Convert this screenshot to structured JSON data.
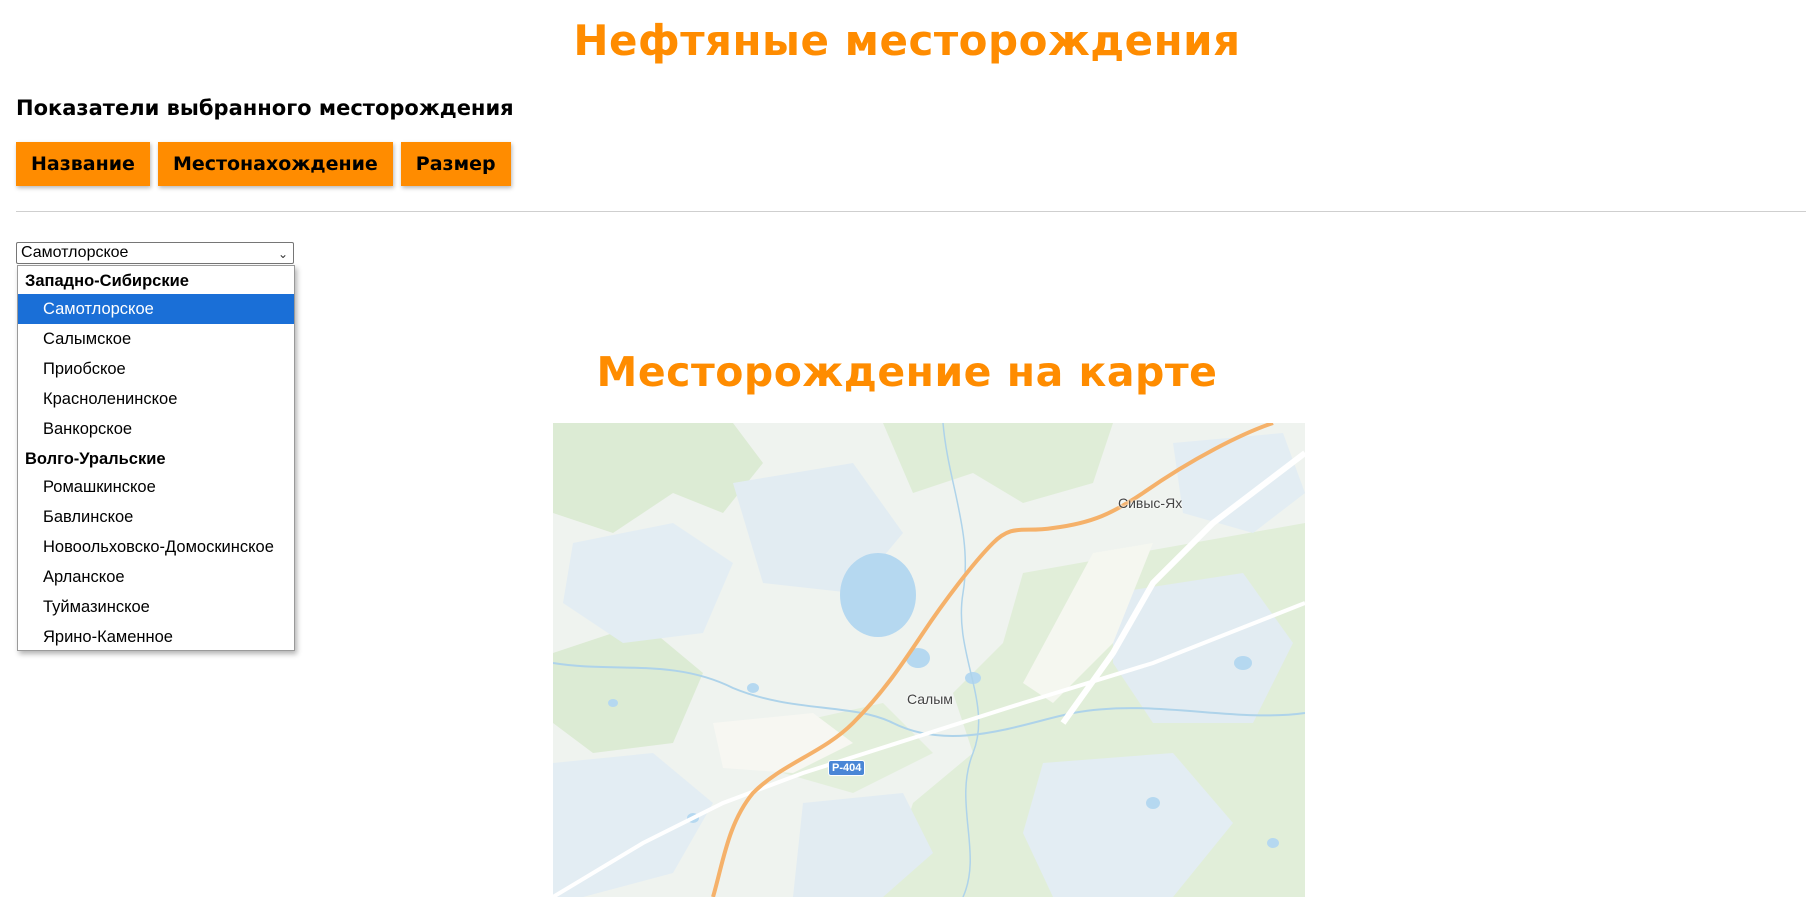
{
  "header": {
    "title": "Нефтяные месторождения"
  },
  "indicators": {
    "title": "Показатели выбранного месторождения",
    "buttons": {
      "name": "Название",
      "location": "Местонахождение",
      "size": "Размер"
    }
  },
  "field_select": {
    "selected": "Самотлорское",
    "groups": [
      {
        "label": "Западно-Сибирские",
        "options": [
          "Самотлорское",
          "Салымское",
          "Приобское",
          "Красноленинское",
          "Ванкорское"
        ]
      },
      {
        "label": "Волго-Уральские",
        "options": [
          "Ромашкинское",
          "Бавлинское",
          "Новоольховско-Домоскинское",
          "Арланское",
          "Туймазинское",
          "Ярино-Каменное"
        ]
      }
    ]
  },
  "map_section": {
    "title": "Месторождение на карте",
    "labels": {
      "village_1": "Сивыс-Ях",
      "village_2": "Салым",
      "road": "Р-404"
    }
  },
  "colors": {
    "accent": "#ff8c00",
    "selected_option": "#1a6fd7"
  }
}
